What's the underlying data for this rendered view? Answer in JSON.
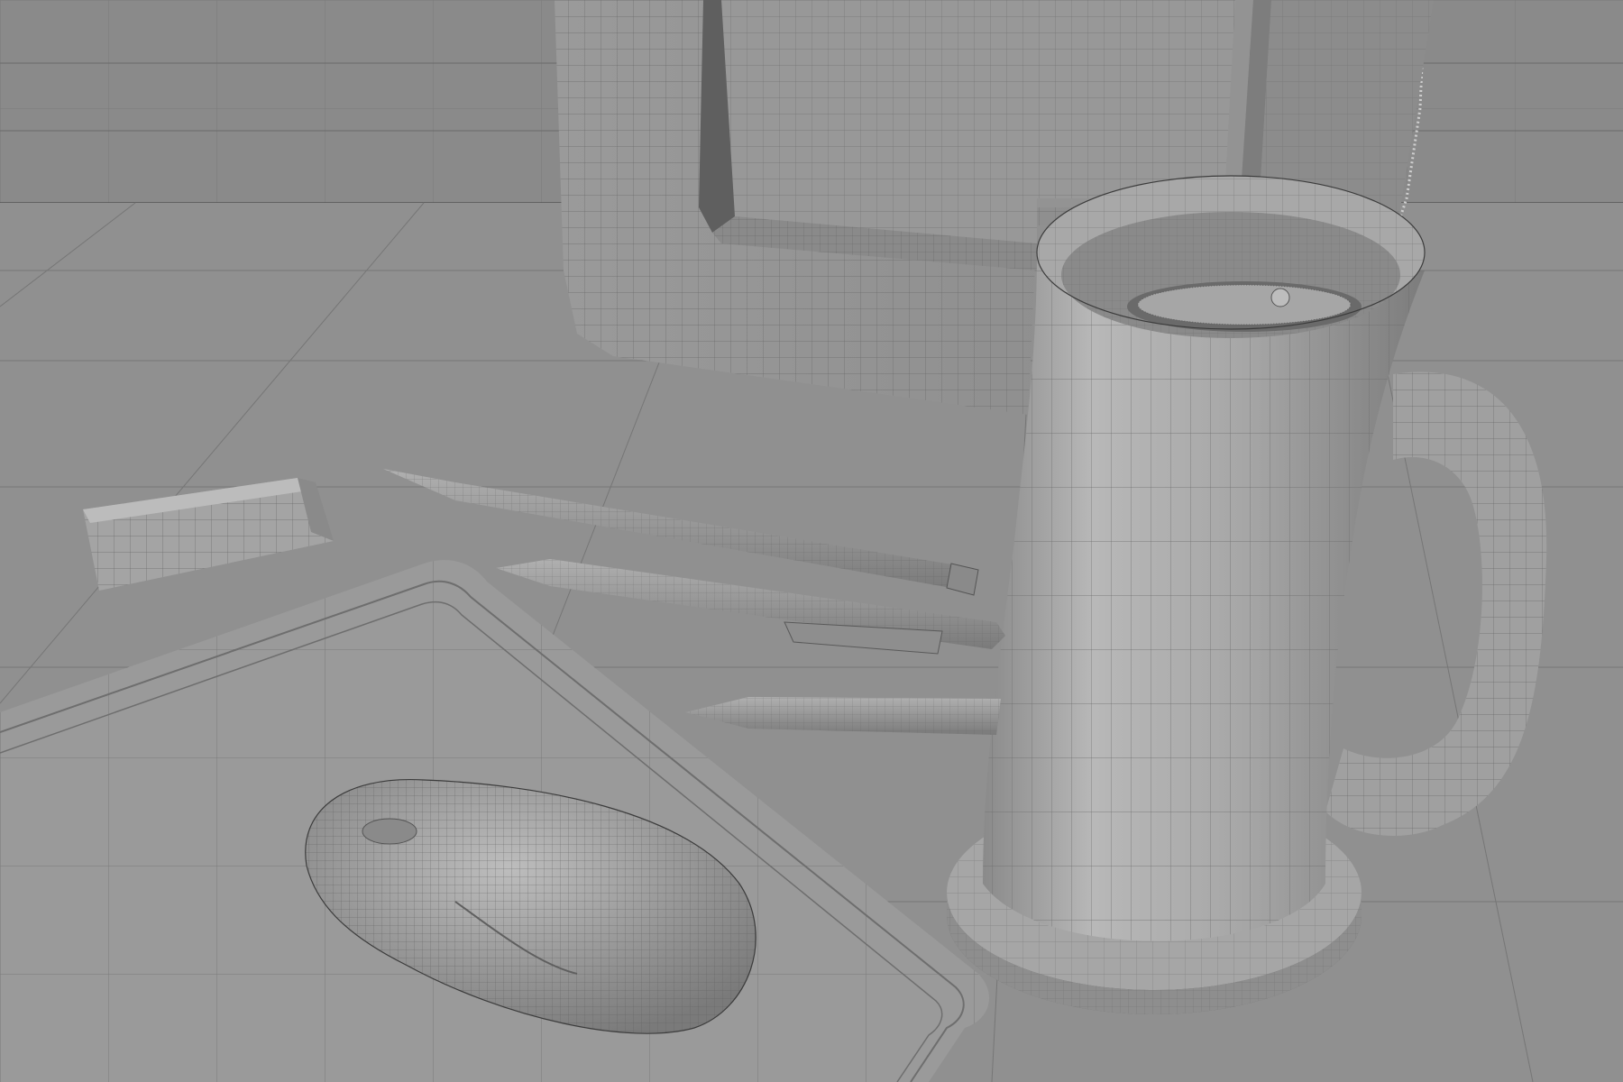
{
  "viewport": {
    "label": "",
    "render_mode": "wireframe-on-shaded",
    "colors": {
      "background_wall": "#888888",
      "floor": "#929292",
      "surface": "#9c9c9c",
      "surface_light": "#b4b4b4",
      "surface_dark": "#6e6e6e",
      "wire": "#5a5a5a",
      "edge": "#3c3c3c"
    }
  },
  "scene": {
    "objects": [
      {
        "id": "picture-frame",
        "icon": "frame-mesh"
      },
      {
        "id": "mug",
        "icon": "mug-mesh"
      },
      {
        "id": "coaster",
        "icon": "disc-mesh"
      },
      {
        "id": "eraser",
        "icon": "box-mesh"
      },
      {
        "id": "pencil",
        "icon": "cylinder-mesh"
      },
      {
        "id": "pen",
        "icon": "cylinder-mesh"
      },
      {
        "id": "marker",
        "icon": "cylinder-mesh"
      },
      {
        "id": "mouse-pad",
        "icon": "plane-mesh"
      },
      {
        "id": "mouse",
        "icon": "mouse-mesh"
      }
    ]
  }
}
